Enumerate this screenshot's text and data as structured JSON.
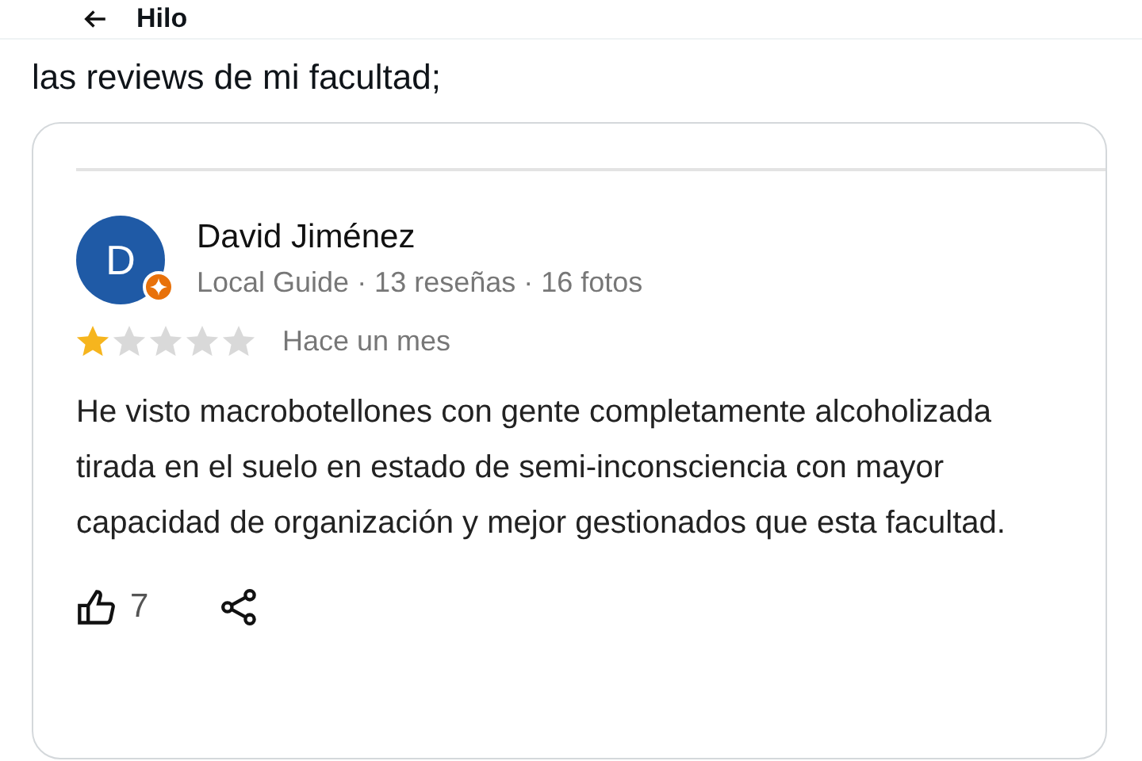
{
  "header": {
    "title": "Hilo"
  },
  "tweet": {
    "text": "las reviews de mi facultad;"
  },
  "review": {
    "author": "David Jiménez",
    "initial": "D",
    "local_guide": true,
    "meta": "Local Guide · 13 reseñas · 16 fotos",
    "stars": 1,
    "time": "Hace un mes",
    "body": "He visto macrobotellones con gente completamente alcoholizada tirada en el suelo en estado de semi-inconsciencia con mayor capacidad de organización y mejor gestionados que esta facultad.",
    "likes": "7"
  }
}
